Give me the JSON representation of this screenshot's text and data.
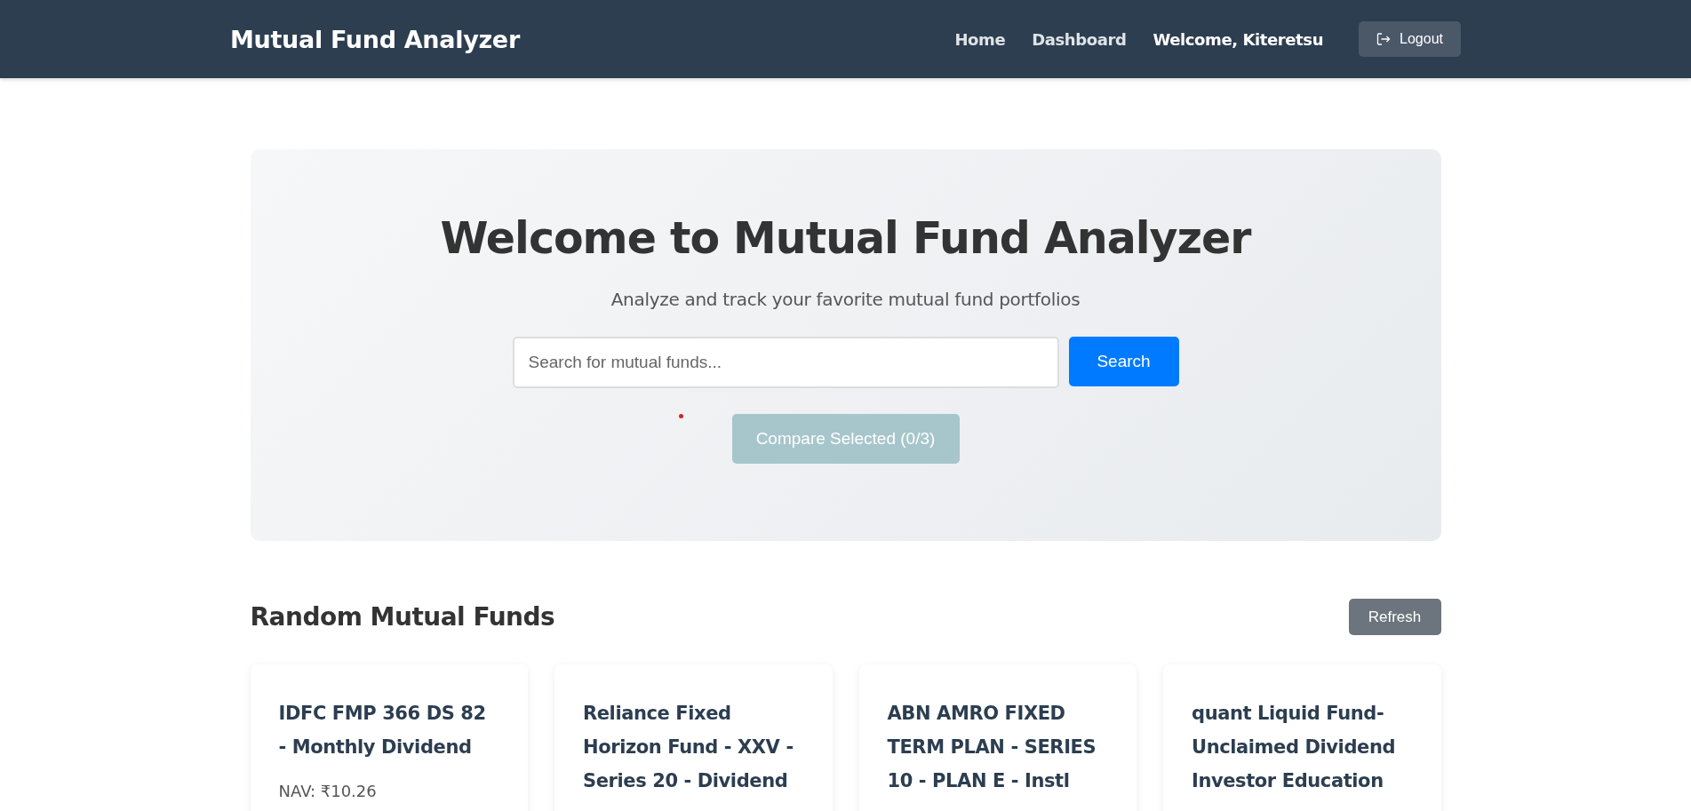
{
  "navbar": {
    "brand": "Mutual Fund Analyzer",
    "links": [
      {
        "label": "Home"
      },
      {
        "label": "Dashboard"
      }
    ],
    "welcome": "Welcome, Kiteretsu",
    "logout": "Logout"
  },
  "hero": {
    "title": "Welcome to Mutual Fund Analyzer",
    "subtitle": "Analyze and track your favorite mutual fund portfolios",
    "search": {
      "placeholder": "Search for mutual funds..."
    },
    "search_button": "Search",
    "compare_button": {
      "label": "Compare Selected (0/3)",
      "disabled": true
    }
  },
  "section": {
    "title": "Random Mutual Funds",
    "refresh": "Refresh"
  },
  "funds": [
    {
      "name": "IDFC FMP 366 DS 82 - Monthly Dividend",
      "nav": "NAV: ₹10.26"
    },
    {
      "name": "Reliance Fixed Horizon Fund - XXV - Series 20 - Dividend"
    },
    {
      "name": "ABN AMRO FIXED TERM PLAN - SERIES 10 - PLAN E - Instl"
    },
    {
      "name": "quant Liquid Fund-Unclaimed Dividend Investor Education"
    }
  ]
}
